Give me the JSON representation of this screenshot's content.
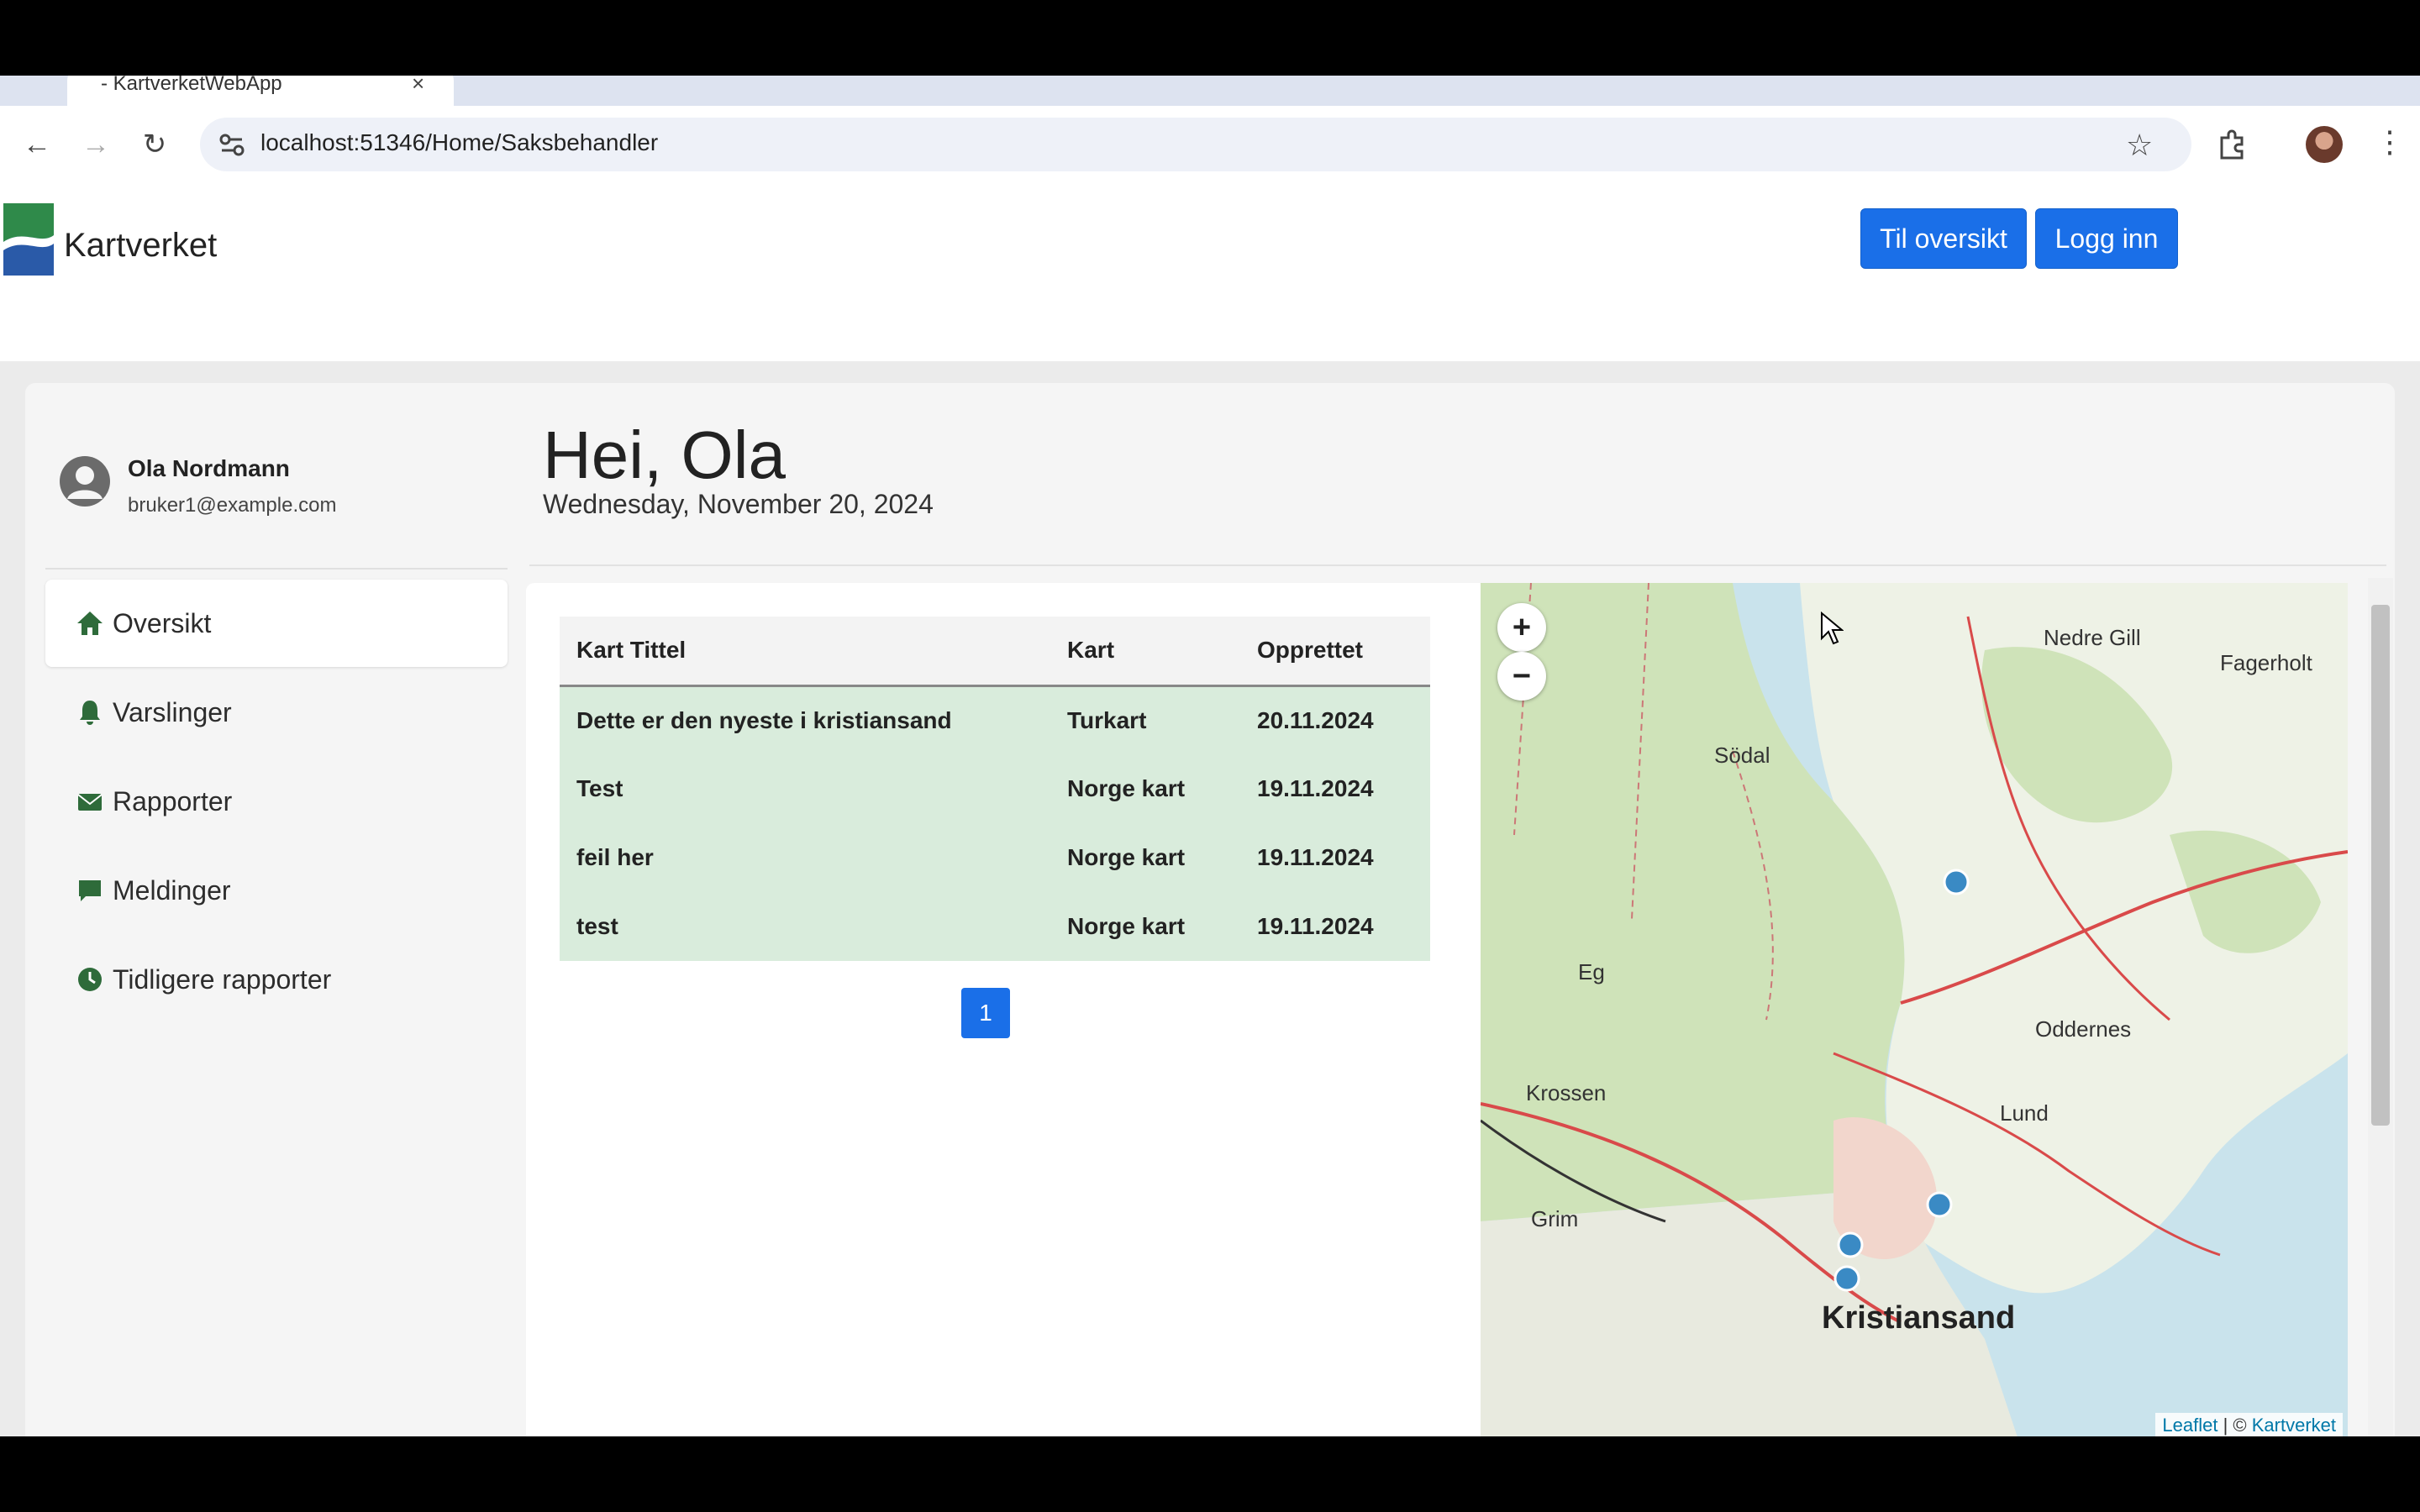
{
  "browser": {
    "tab_title": "- KartverketWebApp",
    "url": "localhost:51346/Home/Saksbehandler"
  },
  "header": {
    "brand": "Kartverket",
    "btn_overview": "Til oversikt",
    "btn_login": "Logg inn"
  },
  "profile": {
    "name": "Ola Nordmann",
    "email": "bruker1@example.com"
  },
  "menu": {
    "items": [
      {
        "label": "Oversikt",
        "icon": "home-icon"
      },
      {
        "label": "Varslinger",
        "icon": "bell-icon"
      },
      {
        "label": "Rapporter",
        "icon": "envelope-icon"
      },
      {
        "label": "Meldinger",
        "icon": "message-icon"
      },
      {
        "label": "Tidligere rapporter",
        "icon": "clock-icon"
      }
    ]
  },
  "main": {
    "greeting": "Hei, Ola",
    "date": "Wednesday, November 20, 2024"
  },
  "table": {
    "headers": [
      "Kart Tittel",
      "Kart",
      "Opprettet"
    ],
    "rows": [
      [
        "Dette er den nyeste i kristiansand",
        "Turkart",
        "20.11.2024"
      ],
      [
        "Test",
        "Norge kart",
        "19.11.2024"
      ],
      [
        "feil her",
        "Norge kart",
        "19.11.2024"
      ],
      [
        "test",
        "Norge kart",
        "19.11.2024"
      ]
    ],
    "page": "1"
  },
  "map": {
    "zoom_in": "+",
    "zoom_out": "−",
    "labels": {
      "kristiansand": "Kristiansand",
      "sodal": "Södal",
      "nedre_gill": "Nedre Gill",
      "fagerholt": "Fagerholt",
      "eg": "Eg",
      "krossen": "Krossen",
      "grim": "Grim",
      "oddernes": "Oddernes",
      "lund": "Lund"
    },
    "attribution_leaflet": "Leaflet",
    "attribution_sep": " | © ",
    "attribution_kv": "Kartverket",
    "colors": {
      "water": "#c9e3ec",
      "land": "#eef2e6",
      "forest": "#cfe3b9",
      "road": "#d94a4a",
      "marker": "#3a8ac4"
    }
  }
}
